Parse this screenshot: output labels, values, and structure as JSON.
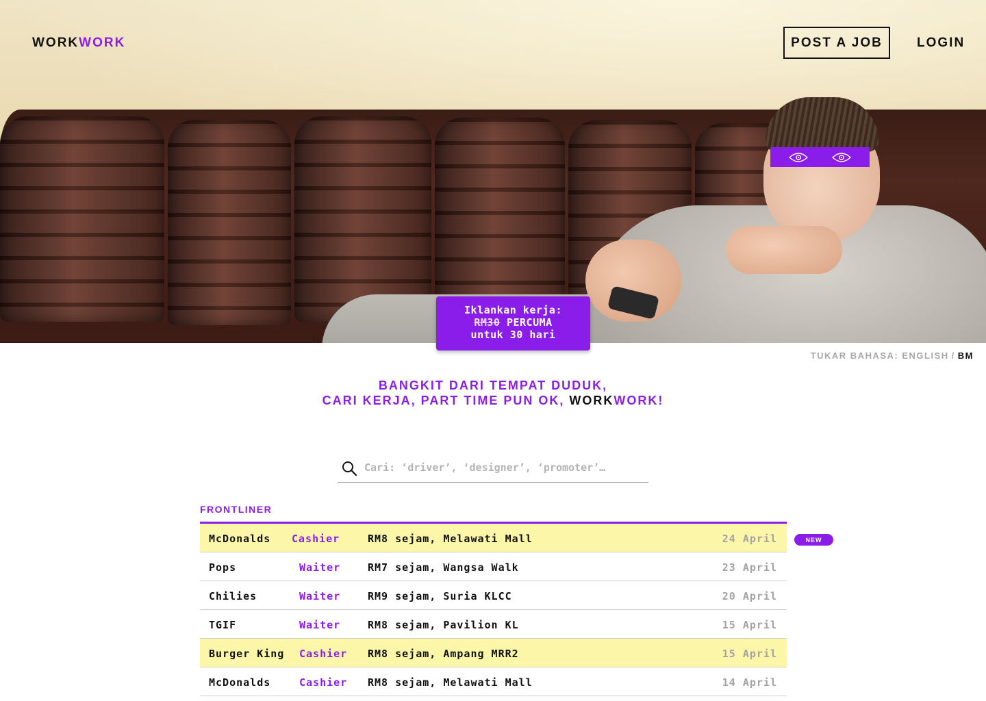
{
  "nav": {
    "brand_part1": "WORK",
    "brand_part2": "WORK",
    "post_job": "POST A JOB",
    "login": "LOGIN"
  },
  "hero": {
    "image_subject": "man-on-sofa-photo",
    "eye_icon": "eye-icon",
    "promo": {
      "line1": "Iklankan kerja:",
      "price_struck": "RM30",
      "price_new": "PERCUMA",
      "line3": "untuk 30 hari"
    }
  },
  "language": {
    "label": "TUKAR BAHASA:",
    "english": "ENGLISH",
    "separator": "/",
    "bm": "BM"
  },
  "tagline": {
    "line1": "BANGKIT DARI TEMPAT DUDUK,",
    "line2": "CARI KERJA, PART TIME PUN OK,",
    "brand_a": "WORK",
    "brand_b": "WORK!"
  },
  "search": {
    "placeholder": "Cari: ‘driver’, ‘designer’, ‘promoter’…",
    "value": ""
  },
  "category": "FRONTLINER",
  "badge_new": "NEW",
  "jobs": [
    {
      "company": "McDonalds",
      "role": "Cashier",
      "detail": "RM8 sejam, Melawati Mall",
      "date": "24 April",
      "highlight": true
    },
    {
      "company": "Pops",
      "role": "Waiter",
      "detail": "RM7 sejam, Wangsa Walk",
      "date": "23 April",
      "highlight": false
    },
    {
      "company": "Chilies",
      "role": "Waiter",
      "detail": "RM9 sejam, Suria KLCC",
      "date": "20 April",
      "highlight": false
    },
    {
      "company": "TGIF",
      "role": "Waiter",
      "detail": "RM8 sejam, Pavilion KL",
      "date": "15 April",
      "highlight": false
    },
    {
      "company": "Burger King",
      "role": "Cashier",
      "detail": "RM8 sejam, Ampang MRR2",
      "date": "15 April",
      "highlight": true
    },
    {
      "company": "McDonalds",
      "role": "Cashier",
      "detail": "RM8 sejam, Melawati Mall",
      "date": "14 April",
      "highlight": false
    }
  ],
  "colors": {
    "accent": "#8a1dea",
    "highlight_row": "#fbf6a8",
    "muted": "#a3a3a3"
  }
}
